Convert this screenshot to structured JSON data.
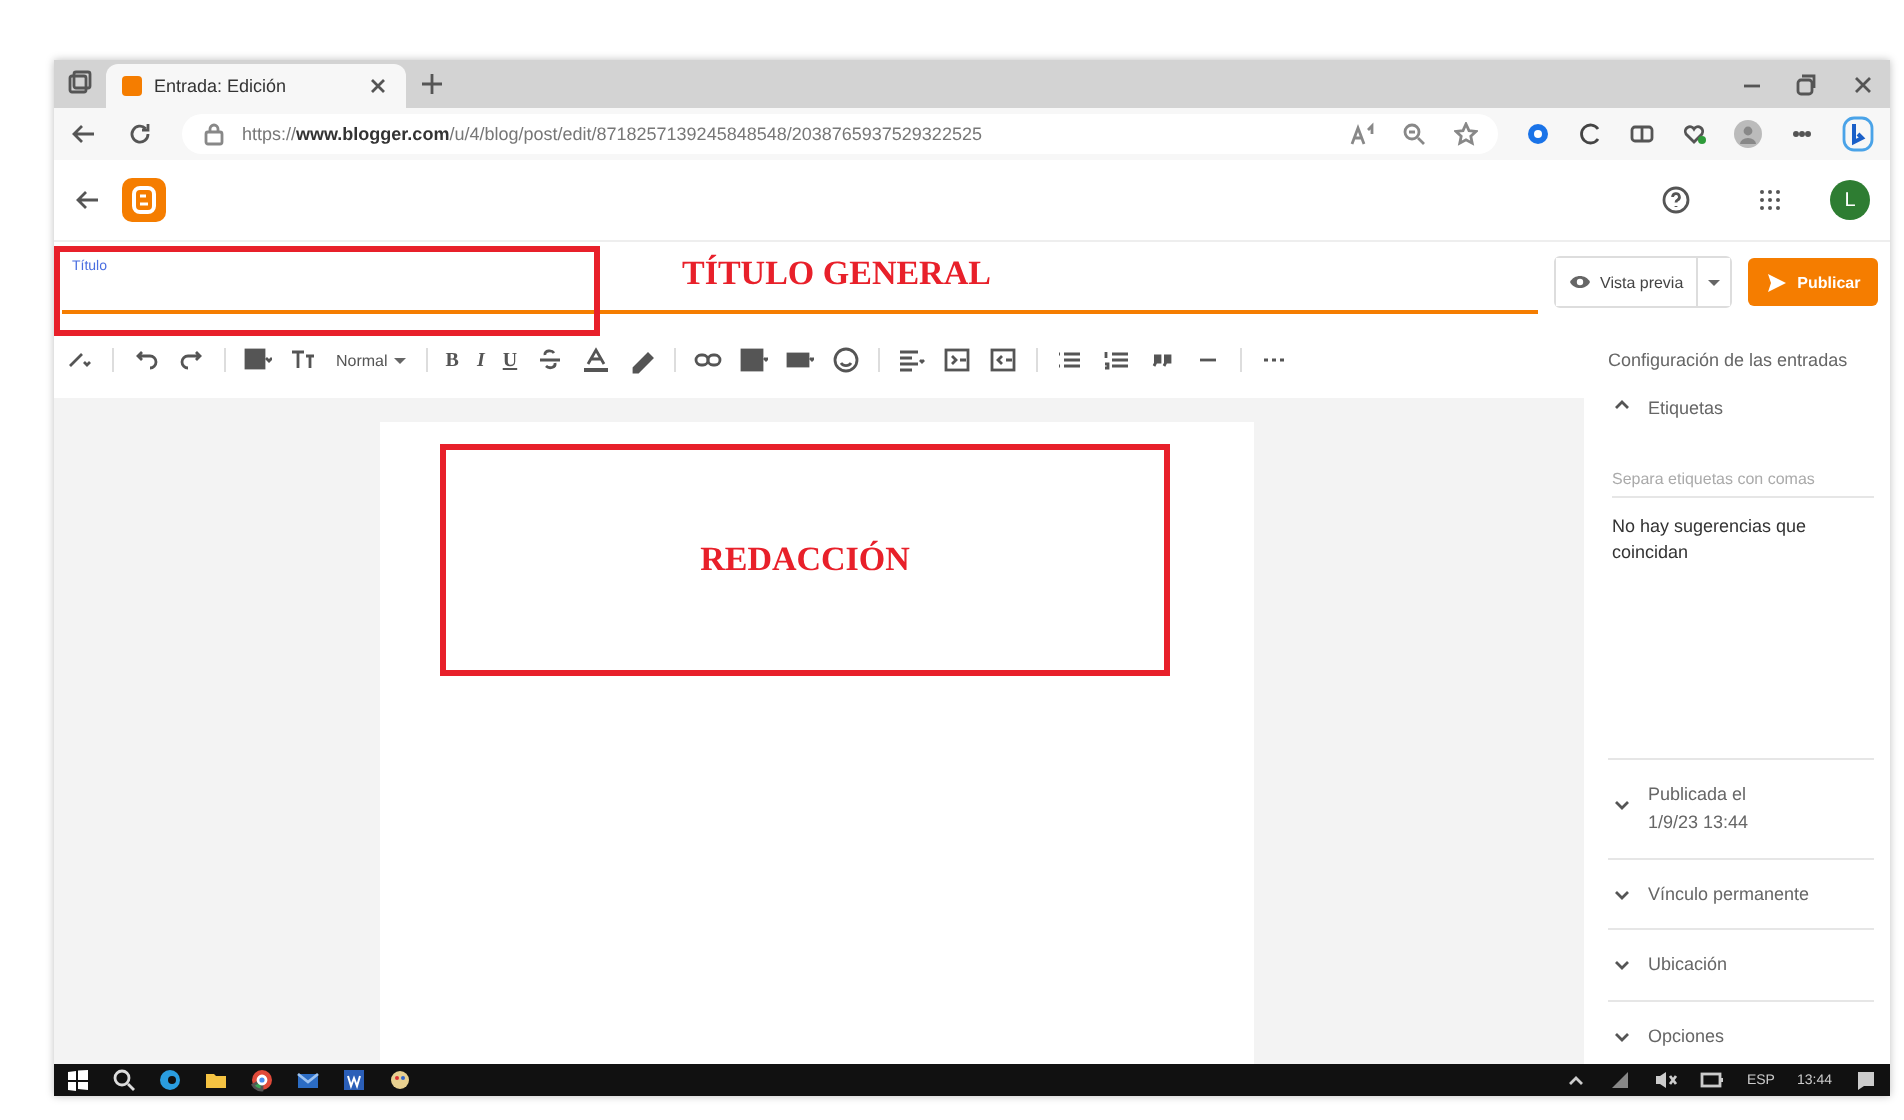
{
  "browser": {
    "tab": {
      "title": "Entrada: Edición",
      "selected": true
    },
    "url": "https://**www.blogger.com**/u/4/blog/post/edit/8718257139245848548/2038765937529322525"
  },
  "header": {
    "avatar": "L"
  },
  "title_field": {
    "label": "Título"
  },
  "buttons": {
    "preview": "Vista previa",
    "publish": "Publicar"
  },
  "toolbar": {
    "format": "Normal",
    "text_buttons": [
      "B",
      "I",
      "U"
    ]
  },
  "annotations": [
    {
      "text": "TÍTULO GENERAL"
    },
    {
      "text": "REDACCIÓN"
    }
  ],
  "sidebar": {
    "heading": "Configuración de las entradas",
    "sections": [
      {
        "label": "Etiquetas",
        "expanded": true,
        "placeholder": "Separa etiquetas con comas",
        "note": "No hay sugerencias que coincidan"
      },
      {
        "label": "Publicada el",
        "value": "1/9/23 13:44",
        "expanded": false
      },
      {
        "label": "Vínculo permanente",
        "expanded": false
      },
      {
        "label": "Ubicación",
        "expanded": false
      },
      {
        "label": "Opciones",
        "expanded": false
      }
    ]
  },
  "taskbar": {
    "language": "ESP",
    "time": "13:44"
  }
}
